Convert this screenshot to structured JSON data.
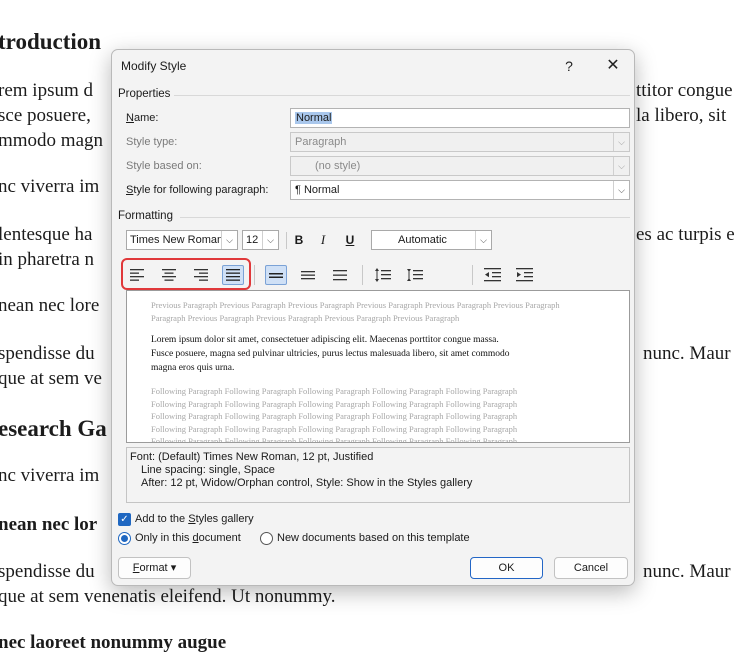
{
  "background_doc": {
    "lines": [
      {
        "text": "troduction",
        "kind": "h1"
      },
      {
        "text": "rem ipsum d",
        "kind": "p"
      },
      {
        "text": "sce posuere,",
        "kind": "p"
      },
      {
        "text": "mmodo magn",
        "kind": "p"
      },
      {
        "text": "nc viverra im",
        "kind": "p"
      },
      {
        "text": "lentesque ha",
        "kind": "p"
      },
      {
        "text": "in pharetra n",
        "kind": "p"
      },
      {
        "text": "nean nec lore",
        "kind": "p"
      },
      {
        "text": "spendisse du",
        "kind": "p"
      },
      {
        "text": "que at sem ve",
        "kind": "p"
      },
      {
        "text": "esearch Ga",
        "kind": "h1"
      },
      {
        "text": "nc viverra im",
        "kind": "p"
      },
      {
        "text": "nean nec lor",
        "kind": "h2"
      },
      {
        "text": "spendisse du",
        "kind": "p"
      },
      {
        "text": "que at sem venenatis eleifend. Ut nonummy.",
        "kind": "p"
      },
      {
        "text": "nec laoreet nonummy augue",
        "kind": "h2"
      }
    ],
    "right_fragments": [
      "ttitor congue",
      "la libero, sit",
      "es ac turpis e",
      "nunc. Maur",
      "nunc. Maur"
    ]
  },
  "dialog": {
    "title": "Modify Style",
    "help_glyph": "?",
    "close_glyph": "✕",
    "properties": {
      "section_label": "Properties",
      "name_label": "Name:",
      "name_value": "Normal",
      "style_type_label": "Style type:",
      "style_type_value": "Paragraph",
      "based_on_label": "Style based on:",
      "based_on_value": "(no style)",
      "following_label": "Style for following paragraph:",
      "following_value": "¶  Normal"
    },
    "formatting": {
      "section_label": "Formatting",
      "font": "Times New Roman",
      "size": "12",
      "bold": "B",
      "italic": "I",
      "underline": "U",
      "color": "Automatic",
      "alignment_selected": "justify",
      "alignment_icons": [
        "align-left-icon",
        "align-center-icon",
        "align-right-icon",
        "justify-icon"
      ],
      "spacing_icons": [
        "single-spacing-icon",
        "one-and-half-spacing-icon",
        "double-spacing-icon"
      ],
      "paragraph_spacing_icons": [
        "increase-paragraph-spacing-icon",
        "decrease-paragraph-spacing-icon"
      ],
      "indent_icons": [
        "decrease-indent-icon",
        "increase-indent-icon"
      ],
      "highlight_color": "#e0383a"
    },
    "preview": {
      "previous_lines": [
        "Previous Paragraph Previous Paragraph Previous Paragraph Previous Paragraph Previous Paragraph Previous Paragraph",
        "Paragraph Previous Paragraph Previous Paragraph Previous Paragraph Previous Paragraph"
      ],
      "sample_lines": [
        "Lorem ipsum dolor sit amet, consectetuer adipiscing elit. Maecenas porttitor congue massa.",
        "Fusce posuere, magna sed pulvinar ultricies, purus lectus malesuada libero, sit amet commodo",
        "magna eros quis urna."
      ],
      "following_lines": [
        "Following Paragraph Following Paragraph Following Paragraph Following Paragraph Following Paragraph",
        "Following Paragraph Following Paragraph Following Paragraph Following Paragraph Following Paragraph",
        "Following Paragraph Following Paragraph Following Paragraph Following Paragraph Following Paragraph",
        "Following Paragraph Following Paragraph Following Paragraph Following Paragraph Following Paragraph",
        "Following Paragraph Following Paragraph Following Paragraph Following Paragraph Following Paragraph"
      ]
    },
    "description": {
      "line1": "Font: (Default) Times New Roman, 12 pt, Justified",
      "line2": "Line spacing:  single, Space",
      "line3": "After:  12 pt, Widow/Orphan control, Style: Show in the Styles gallery"
    },
    "options": {
      "add_to_gallery": "Add to the Styles gallery",
      "add_to_gallery_checked": true,
      "only_this_document": "Only in this document",
      "new_documents": "New documents based on this template",
      "scope_selected": "only_this_document"
    },
    "buttons": {
      "format": "Format",
      "format_arrow": "▾",
      "ok": "OK",
      "cancel": "Cancel"
    },
    "colors": {
      "accent": "#1f67c1",
      "selection": "#a9c7ec",
      "active_tool": "#cfe0f6"
    }
  }
}
